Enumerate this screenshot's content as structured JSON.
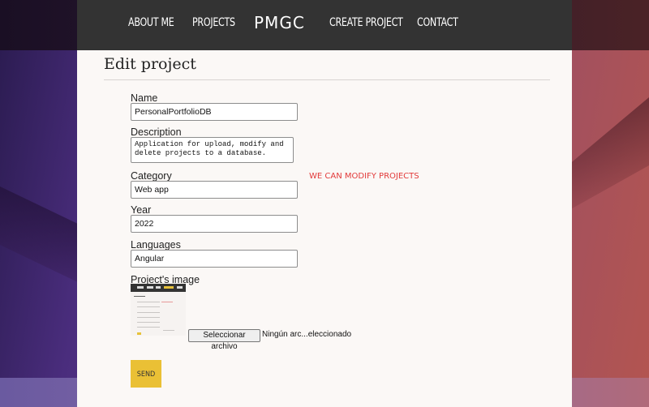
{
  "nav": {
    "items": [
      "ABOUT ME",
      "PROJECTS",
      "CREATE PROJECT",
      "CONTACT"
    ],
    "logo": "PMGC"
  },
  "page": {
    "title": "Edit project"
  },
  "form": {
    "name_label": "Name",
    "name_value": "PersonalPortfolioDB",
    "description_label": "Description",
    "description_value": "Application for upload, modify and delete projects to a database.",
    "category_label": "Category",
    "category_value": "Web app",
    "year_label": "Year",
    "year_value": "2022",
    "languages_label": "Languages",
    "languages_value": "Angular",
    "image_label": "Project's image",
    "file_button": "Seleccionar archivo",
    "file_status": "Ningún arc...eleccionado",
    "send_label": "SEND"
  },
  "hint": "WE CAN MODIFY PROJECTS",
  "colors": {
    "navbar": "#333333",
    "accent": "#eac035",
    "hint": "#e23a3a"
  }
}
